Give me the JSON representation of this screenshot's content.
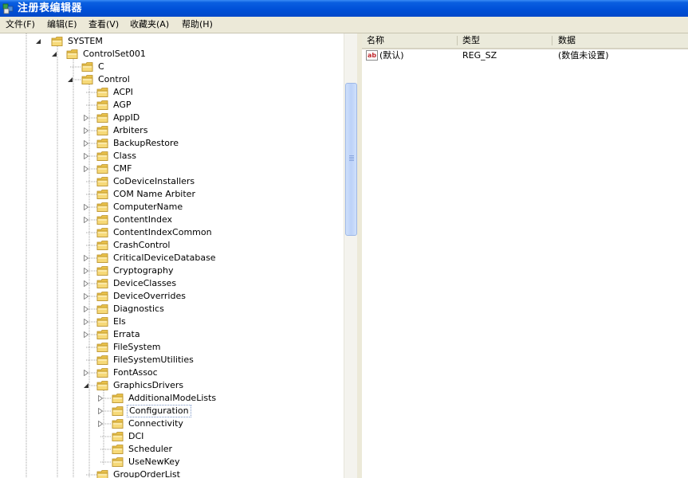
{
  "window": {
    "title": "注册表编辑器"
  },
  "menu": [
    "文件(F)",
    "编辑(E)",
    "查看(V)",
    "收藏夹(A)",
    "帮助(H)"
  ],
  "tree": [
    {
      "label": "SYSTEM",
      "level": 0,
      "expander": "expanded"
    },
    {
      "label": "ControlSet001",
      "level": 1,
      "expander": "expanded"
    },
    {
      "label": "C",
      "level": 2,
      "expander": "none"
    },
    {
      "label": "Control",
      "level": 2,
      "expander": "expanded"
    },
    {
      "label": "ACPI",
      "level": 3,
      "expander": "none"
    },
    {
      "label": "AGP",
      "level": 3,
      "expander": "none"
    },
    {
      "label": "AppID",
      "level": 3,
      "expander": "collapsed"
    },
    {
      "label": "Arbiters",
      "level": 3,
      "expander": "collapsed"
    },
    {
      "label": "BackupRestore",
      "level": 3,
      "expander": "collapsed"
    },
    {
      "label": "Class",
      "level": 3,
      "expander": "collapsed"
    },
    {
      "label": "CMF",
      "level": 3,
      "expander": "collapsed"
    },
    {
      "label": "CoDeviceInstallers",
      "level": 3,
      "expander": "none"
    },
    {
      "label": "COM Name Arbiter",
      "level": 3,
      "expander": "none"
    },
    {
      "label": "ComputerName",
      "level": 3,
      "expander": "collapsed"
    },
    {
      "label": "ContentIndex",
      "level": 3,
      "expander": "collapsed"
    },
    {
      "label": "ContentIndexCommon",
      "level": 3,
      "expander": "none"
    },
    {
      "label": "CrashControl",
      "level": 3,
      "expander": "none"
    },
    {
      "label": "CriticalDeviceDatabase",
      "level": 3,
      "expander": "collapsed"
    },
    {
      "label": "Cryptography",
      "level": 3,
      "expander": "collapsed"
    },
    {
      "label": "DeviceClasses",
      "level": 3,
      "expander": "collapsed"
    },
    {
      "label": "DeviceOverrides",
      "level": 3,
      "expander": "collapsed"
    },
    {
      "label": "Diagnostics",
      "level": 3,
      "expander": "collapsed"
    },
    {
      "label": "Els",
      "level": 3,
      "expander": "collapsed"
    },
    {
      "label": "Errata",
      "level": 3,
      "expander": "collapsed"
    },
    {
      "label": "FileSystem",
      "level": 3,
      "expander": "none"
    },
    {
      "label": "FileSystemUtilities",
      "level": 3,
      "expander": "none"
    },
    {
      "label": "FontAssoc",
      "level": 3,
      "expander": "collapsed"
    },
    {
      "label": "GraphicsDrivers",
      "level": 3,
      "expander": "expanded"
    },
    {
      "label": "AdditionalModeLists",
      "level": 4,
      "expander": "collapsed"
    },
    {
      "label": "Configuration",
      "level": 4,
      "expander": "collapsed",
      "selected": true
    },
    {
      "label": "Connectivity",
      "level": 4,
      "expander": "collapsed"
    },
    {
      "label": "DCI",
      "level": 4,
      "expander": "none"
    },
    {
      "label": "Scheduler",
      "level": 4,
      "expander": "none"
    },
    {
      "label": "UseNewKey",
      "level": 4,
      "expander": "none"
    },
    {
      "label": "GroupOrderList",
      "level": 3,
      "expander": "none"
    }
  ],
  "list": {
    "columns": [
      "名称",
      "类型",
      "数据"
    ],
    "rows": [
      {
        "name": "(默认)",
        "type": "REG_SZ",
        "data": "(数值未设置)",
        "icon": "string-value-icon"
      }
    ]
  },
  "colors": {
    "titlebar": "#0050d8",
    "folder": "#f2d36b",
    "selection_border": "#7a96c8"
  }
}
